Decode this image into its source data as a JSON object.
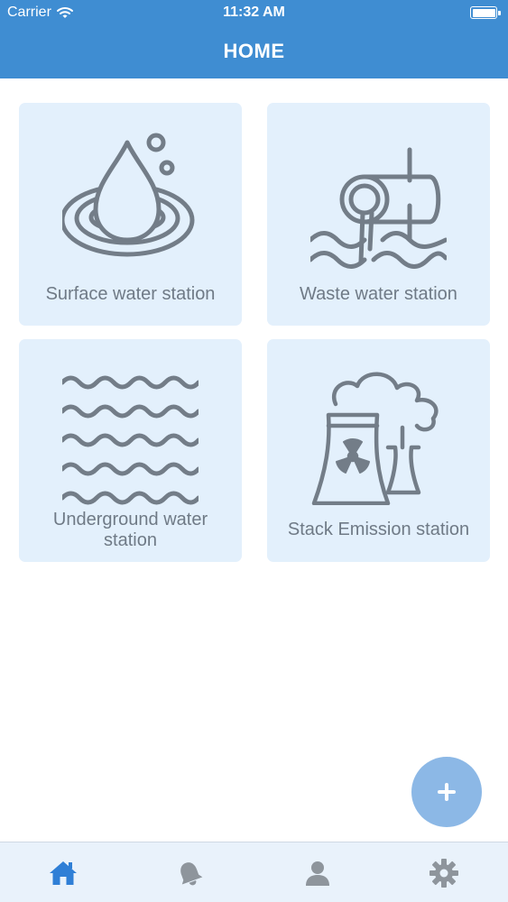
{
  "status_bar": {
    "carrier": "Carrier",
    "time": "11:32 AM",
    "wifi_icon": "wifi-icon",
    "battery_icon": "battery-icon"
  },
  "header": {
    "title": "HOME",
    "background_color": "#3f8dd2"
  },
  "stations": [
    {
      "label": "Surface water station",
      "icon": "water-drop-icon"
    },
    {
      "label": "Waste water station",
      "icon": "waste-pipe-icon"
    },
    {
      "label": "Underground water station",
      "icon": "waves-icon"
    },
    {
      "label": "Stack Emission station",
      "icon": "cooling-tower-icon"
    }
  ],
  "card_color": "#e3f0fc",
  "fab": {
    "icon": "plus-icon",
    "color": "#8cb8e6"
  },
  "tabbar": {
    "active_color": "#2f7fd6",
    "inactive_color": "#8e959c",
    "tabs": [
      {
        "icon": "home-icon",
        "active": true
      },
      {
        "icon": "bell-icon",
        "active": false
      },
      {
        "icon": "user-icon",
        "active": false
      },
      {
        "icon": "gear-icon",
        "active": false
      }
    ]
  }
}
